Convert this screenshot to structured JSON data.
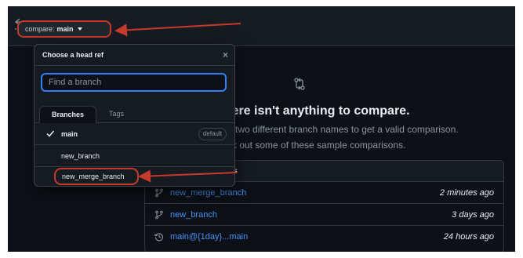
{
  "topbar": {
    "compare_prefix": "compare:",
    "compare_branch": "main"
  },
  "main": {
    "heading": "There isn't anything to compare.",
    "subtext_line1": "e two different branch names to get a valid comparison.",
    "subtext_line2": "ck out some of these sample comparisons.",
    "samples_header": "ons",
    "samples": [
      {
        "icon": "branch-icon",
        "label": "new_merge_branch",
        "time": "2 minutes ago"
      },
      {
        "icon": "branch-icon",
        "label": "new_branch",
        "time": "3 days ago"
      },
      {
        "icon": "history-icon",
        "label": "main@{1day}...main",
        "time": "24 hours ago"
      }
    ]
  },
  "dropdown": {
    "title": "Choose a head ref",
    "close_glyph": "×",
    "search_placeholder": "Find a branch",
    "tabs": {
      "branches": "Branches",
      "tags": "Tags"
    },
    "items": [
      {
        "label": "main",
        "checked": true,
        "badge": "default"
      },
      {
        "label": "new_branch",
        "checked": false
      },
      {
        "label": "new_merge_branch",
        "checked": false
      }
    ]
  },
  "colors": {
    "background": "#0d1117",
    "annotation": "#c63a2b",
    "link": "#4493f8",
    "focus": "#2f81f7"
  }
}
